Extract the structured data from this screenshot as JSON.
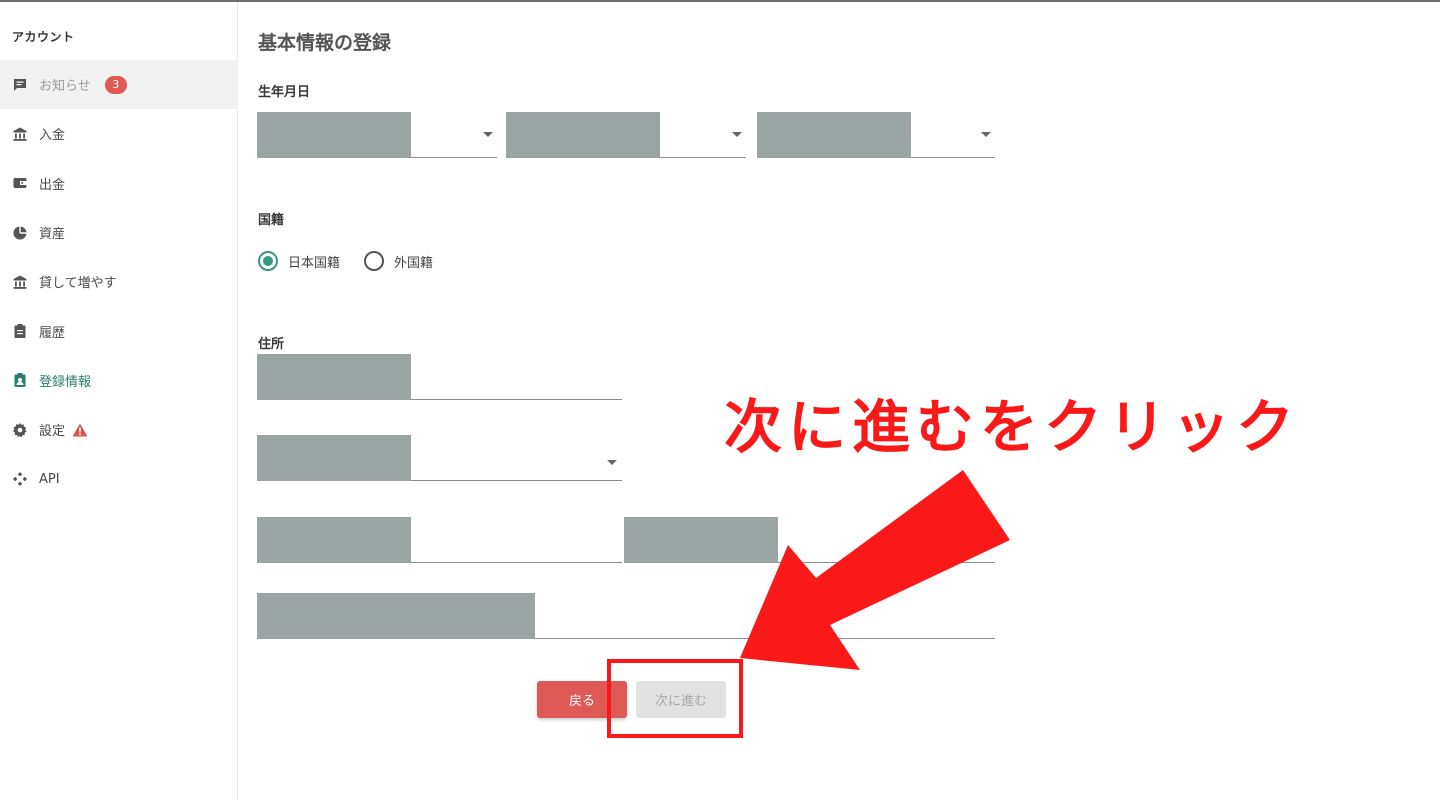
{
  "sidebar": {
    "heading": "アカウント",
    "items": [
      {
        "label": "お知らせ",
        "icon": "message-icon",
        "badge": "3"
      },
      {
        "label": "入金",
        "icon": "bank-icon"
      },
      {
        "label": "出金",
        "icon": "wallet-icon"
      },
      {
        "label": "資産",
        "icon": "pie-chart-icon"
      },
      {
        "label": "貸して増やす",
        "icon": "bank-icon"
      },
      {
        "label": "履歴",
        "icon": "clipboard-icon"
      },
      {
        "label": "登録情報",
        "icon": "id-badge-icon"
      },
      {
        "label": "設定",
        "icon": "gear-icon",
        "warning": "warning-icon"
      },
      {
        "label": "API",
        "icon": "api-icon"
      }
    ]
  },
  "main": {
    "title": "基本情報の登録",
    "birth_label": "生年月日",
    "nationality_label": "国籍",
    "nationality_options": [
      {
        "label": "日本国籍",
        "checked": true
      },
      {
        "label": "外国籍",
        "checked": false
      }
    ],
    "address_label": "住所",
    "back_button": "戻る",
    "next_button": "次に進む"
  },
  "annotation": {
    "text": "次に進むをクリック",
    "color": "#fa1919"
  },
  "colors": {
    "accent": "#3a9582",
    "danger": "#df5a55",
    "mask": "#99a4a3"
  }
}
